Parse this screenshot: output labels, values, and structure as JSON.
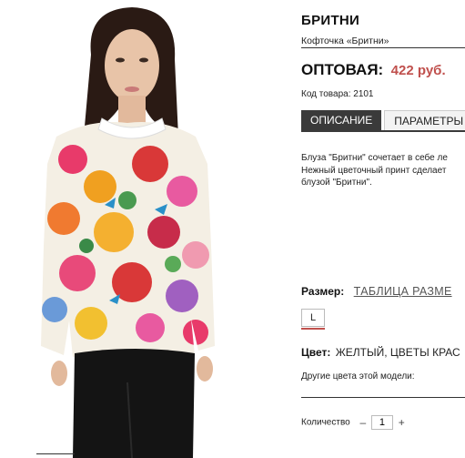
{
  "product": {
    "title": "БРИТНИ",
    "subtitle": "Кофточка «Бритни»",
    "price_label": "ОПТОВАЯ:",
    "price_value": "422 руб.",
    "sku": "Код товара: 2101"
  },
  "tabs": [
    {
      "label": "ОПИСАНИЕ",
      "active": true
    },
    {
      "label": "ПАРАМЕТРЫ",
      "active": false
    }
  ],
  "description": [
    "Блуза \"Бритни\" сочетает в себе ле",
    "Нежный цветочный принт сделает",
    "блузой \"Бритни\"."
  ],
  "size": {
    "label": "Размер:",
    "table_link": "ТАБЛИЦА РАЗМЕ",
    "options": [
      "L"
    ]
  },
  "color": {
    "label": "Цвет:",
    "value": "ЖЕЛТЫЙ, ЦВЕТЫ КРАС"
  },
  "other_colors_label": "Другие цвета этой модели:",
  "quantity": {
    "label": "Количество",
    "minus": "–",
    "value": "1",
    "plus": "+"
  },
  "colors": {
    "price": "#c0504d",
    "tab_active_bg": "#3a3a3a",
    "size_accent": "#c0504d"
  }
}
